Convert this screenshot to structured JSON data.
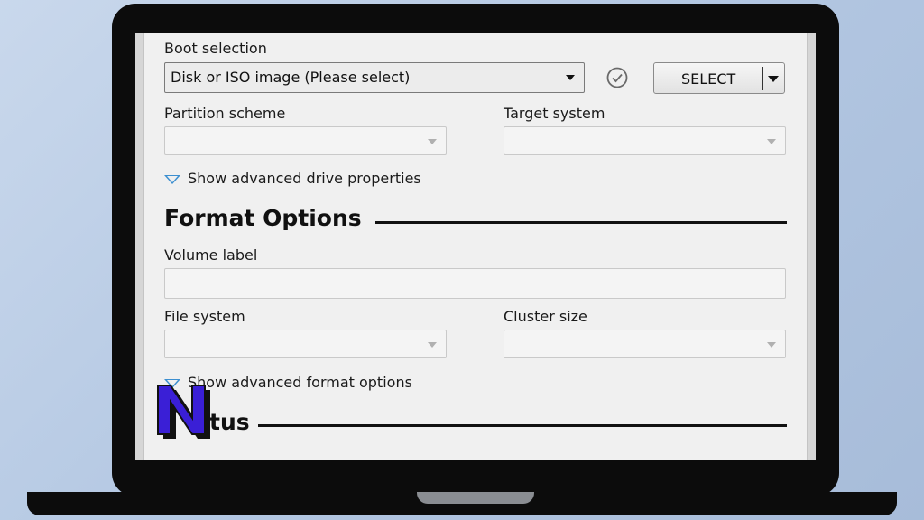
{
  "boot": {
    "label": "Boot selection",
    "value": "Disk or ISO image (Please select)",
    "select_button": "SELECT"
  },
  "partition": {
    "label": "Partition scheme",
    "value": ""
  },
  "target": {
    "label": "Target system",
    "value": ""
  },
  "advanced_drive": "Show advanced drive properties",
  "format": {
    "title": "Format Options",
    "volume_label": "Volume label",
    "volume_value": "",
    "file_system_label": "File system",
    "file_system_value": "",
    "cluster_label": "Cluster size",
    "cluster_value": "",
    "advanced_format": "Show advanced format options"
  },
  "status": {
    "title_visible": "tus"
  },
  "logo_letter": "N",
  "colors": {
    "accent_triangle": "#3c8fd0",
    "logo": "#3a1fd6"
  }
}
